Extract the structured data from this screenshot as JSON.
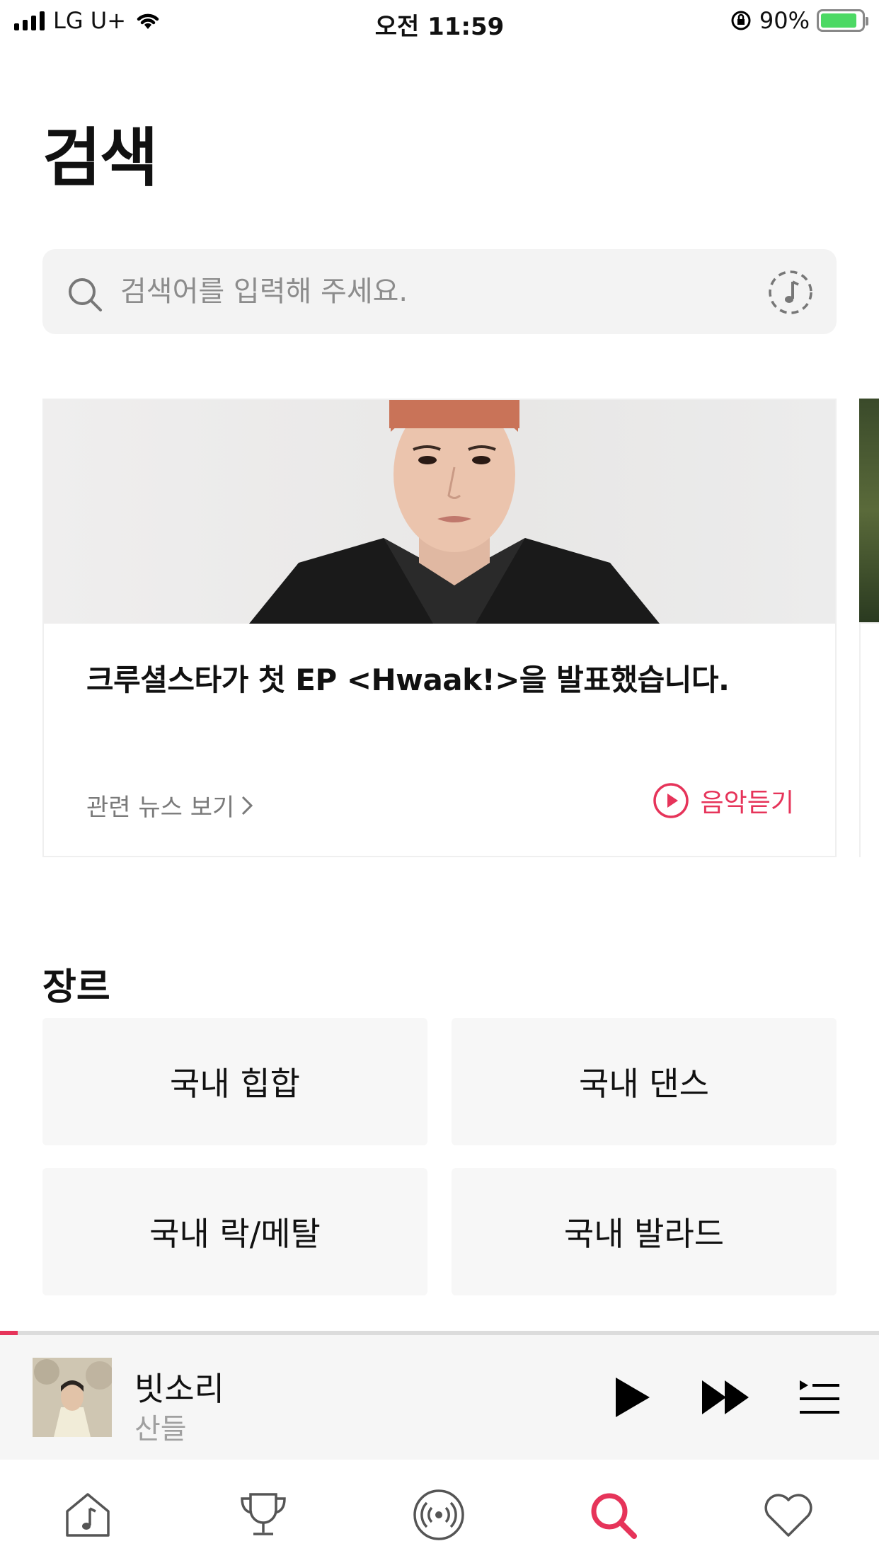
{
  "status_bar": {
    "carrier": "LG U+",
    "time": "오전 11:59",
    "battery_percent": "90%",
    "battery_level": 0.9,
    "battery_color": "#4cd964"
  },
  "page": {
    "title": "검색"
  },
  "search": {
    "placeholder": "검색어를 입력해 주세요.",
    "value": "",
    "search_icon": "search-icon",
    "music_recognition_icon": "music-recognition-icon"
  },
  "feature_card": {
    "headline": "크루셜스타가 첫 EP <Hwaak!>을 발표했습니다.",
    "related_news_label": "관련 뉴스 보기",
    "listen_label": "음악듣기",
    "accent_color": "#e6345a"
  },
  "genre_section": {
    "title": "장르",
    "items": [
      {
        "label": "국내 힙합"
      },
      {
        "label": "국내 댄스"
      },
      {
        "label": "국내 락/메탈"
      },
      {
        "label": "국내 발라드"
      }
    ]
  },
  "mini_player": {
    "song_title": "빗소리",
    "artist": "산들",
    "progress": 0.02,
    "controls": [
      "play-icon",
      "next-icon",
      "playlist-icon"
    ]
  },
  "tab_bar": {
    "tabs": [
      {
        "icon": "home-music-icon",
        "active": false
      },
      {
        "icon": "trophy-icon",
        "active": false
      },
      {
        "icon": "radio-broadcast-icon",
        "active": false
      },
      {
        "icon": "search-icon",
        "active": true
      },
      {
        "icon": "heart-icon",
        "active": false
      }
    ],
    "active_color": "#e6345a"
  }
}
